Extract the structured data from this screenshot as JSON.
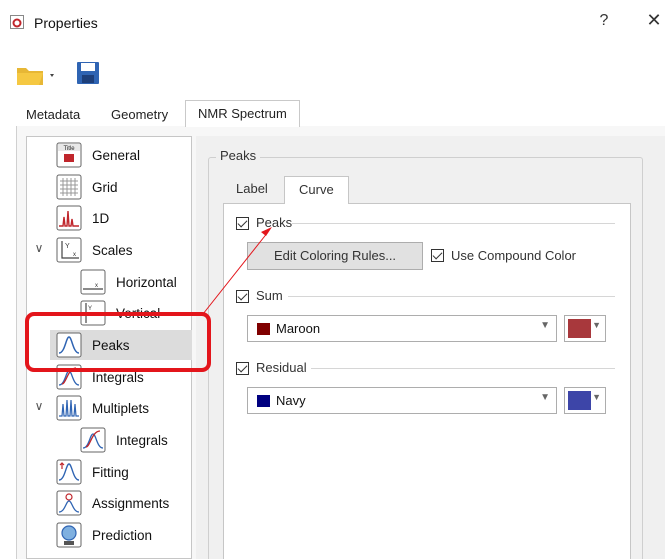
{
  "window": {
    "title": "Properties",
    "help": "?",
    "close": "✕"
  },
  "toolbar": {
    "open_icon": "folder-open-icon",
    "save_icon": "save-icon"
  },
  "tabs": [
    {
      "label": "Metadata",
      "active": false
    },
    {
      "label": "Geometry",
      "active": false
    },
    {
      "label": "NMR Spectrum",
      "active": true
    }
  ],
  "tree": {
    "items": [
      {
        "label": "General",
        "icon": "title-icon"
      },
      {
        "label": "Grid",
        "icon": "grid-icon"
      },
      {
        "label": "1D",
        "icon": "spectrum-1d-icon"
      },
      {
        "label": "Scales",
        "icon": "scales-icon",
        "expanded": true
      },
      {
        "label": "Horizontal",
        "icon": "horizontal-scale-icon"
      },
      {
        "label": "Vertical",
        "icon": "vertical-scale-icon"
      },
      {
        "label": "Peaks",
        "icon": "peaks-icon",
        "selected": true
      },
      {
        "label": "Integrals",
        "icon": "integrals-icon"
      },
      {
        "label": "Multiplets",
        "icon": "multiplets-icon",
        "expanded": true
      },
      {
        "label": "Integrals",
        "icon": "integrals-icon"
      },
      {
        "label": "Fitting",
        "icon": "fitting-icon"
      },
      {
        "label": "Assignments",
        "icon": "assignments-icon"
      },
      {
        "label": "Prediction",
        "icon": "prediction-icon"
      }
    ]
  },
  "peaks_panel": {
    "group_title": "Peaks",
    "subtabs": [
      {
        "label": "Label",
        "active": false
      },
      {
        "label": "Curve",
        "active": true
      }
    ],
    "peaks_checkbox": {
      "label": "Peaks",
      "checked": true
    },
    "edit_coloring_button": "Edit Coloring Rules...",
    "use_compound_color": {
      "label": "Use Compound Color",
      "checked": true
    },
    "sum_checkbox": {
      "label": "Sum",
      "checked": true
    },
    "sum_color": {
      "name": "Maroon",
      "swatch": "#800000",
      "button_color": "#a8383c"
    },
    "residual_checkbox": {
      "label": "Residual",
      "checked": true
    },
    "residual_color": {
      "name": "Navy",
      "swatch": "#000080",
      "button_color": "#3d45a8"
    }
  },
  "colors": {
    "highlight": "#e3151b",
    "selection": "#dcdcdc"
  }
}
